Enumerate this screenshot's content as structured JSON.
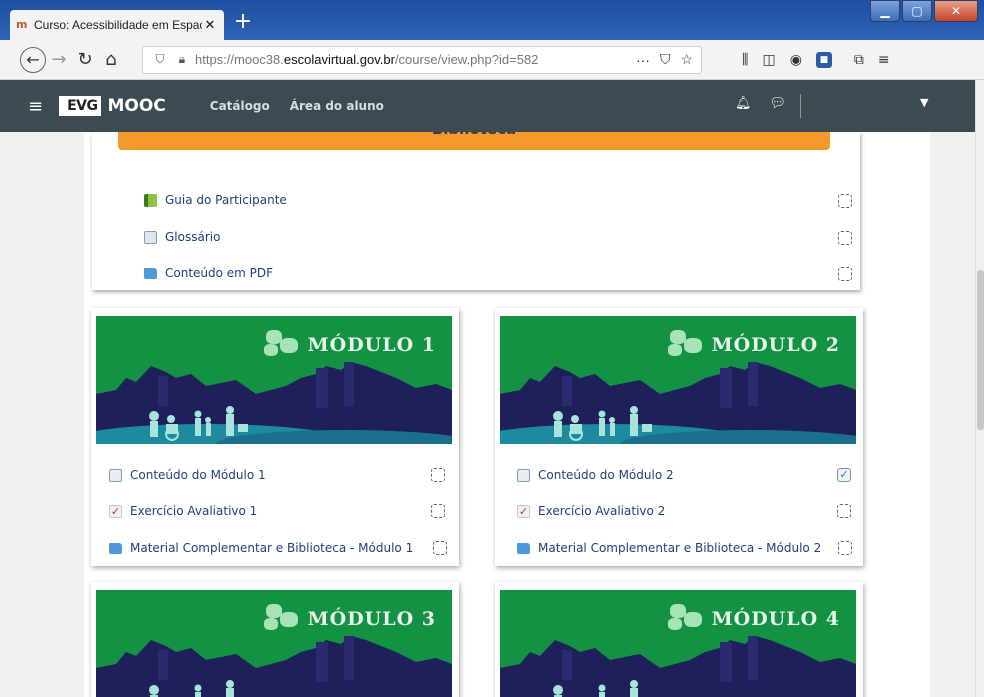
{
  "browser": {
    "tab_title": "Curso: Acessibilidade em Espaç",
    "url_prefix": "https://mooc38.",
    "url_domain": "escolavirtual.gov.br",
    "url_path": "/course/view.php?id=582",
    "url_more": "···"
  },
  "site": {
    "logo": "EVG",
    "brand": "MOOC",
    "nav": [
      "Catálogo",
      "Área do aluno"
    ]
  },
  "biblioteca": {
    "banner": "Biblioteca",
    "items": [
      {
        "label": "Guia do Participante",
        "icon": "book-icon",
        "completed": false
      },
      {
        "label": "Glossário",
        "icon": "glossary-icon",
        "completed": false
      },
      {
        "label": "Conteúdo em PDF",
        "icon": "folder-icon",
        "completed": false
      }
    ]
  },
  "modules": [
    {
      "title": "MÓDULO 1",
      "items": [
        {
          "label": "Conteúdo do Módulo 1",
          "icon": "page-icon",
          "completed": false
        },
        {
          "label": "Exercício Avaliativo 1",
          "icon": "quiz-icon",
          "completed": false
        },
        {
          "label": "Material Complementar e Biblioteca - Módulo 1",
          "icon": "folder-icon",
          "completed": false
        }
      ]
    },
    {
      "title": "MÓDULO 2",
      "items": [
        {
          "label": "Conteúdo do Módulo 2",
          "icon": "page-icon",
          "completed": true
        },
        {
          "label": "Exercício Avaliativo 2",
          "icon": "quiz-icon",
          "completed": false
        },
        {
          "label": "Material Complementar e Biblioteca - Módulo 2",
          "icon": "folder-icon",
          "completed": false
        }
      ]
    },
    {
      "title": "MÓDULO 3",
      "items": []
    },
    {
      "title": "MÓDULO 4",
      "items": []
    }
  ],
  "colors": {
    "header": "#3c4a52",
    "banner_orange": "#f39a2a",
    "module_green": "#129242",
    "skyline_navy": "#1f1f5a",
    "link_blue": "#1f3f7a"
  }
}
